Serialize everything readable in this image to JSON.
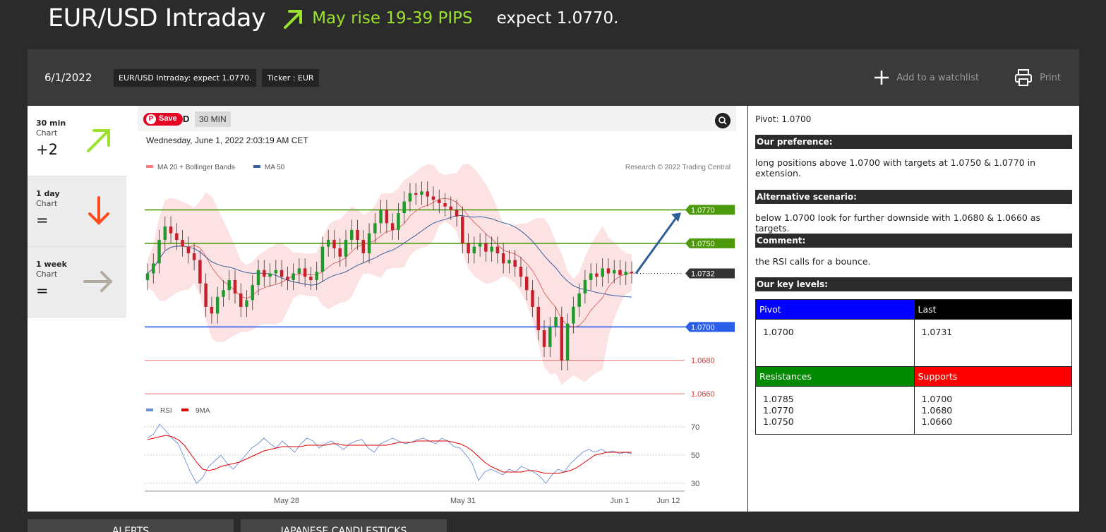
{
  "header": {
    "title": "EUR/USD Intraday",
    "arrow_icon": "arrow-up-right-icon",
    "rise_text": "May rise 19-39 PIPS",
    "expect_text": "expect 1.0770.",
    "accent_color": "#9be22d"
  },
  "infobar": {
    "date": "6/1/2022",
    "tags": [
      "EUR/USD Intraday: expect 1.0770.",
      "Ticker : EUR"
    ],
    "watchlist_label": "Add to a watchlist",
    "print_label": "Print"
  },
  "sidebar": {
    "items": [
      {
        "period": "30 min",
        "chart_label": "Chart",
        "score": "+2",
        "icon": "arrow-up-right-icon",
        "color": "#9be22d"
      },
      {
        "period": "1 day",
        "chart_label": "Chart",
        "score": "=",
        "icon": "arrow-down-icon",
        "color": "#ff4a1c"
      },
      {
        "period": "1 week",
        "chart_label": "Chart",
        "score": "=",
        "icon": "arrow-right-icon",
        "color": "#b3aaa0"
      }
    ]
  },
  "chart": {
    "save_label": "Save",
    "symbol_suffix": "D",
    "timeframe": "30 MIN",
    "timestamp": "Wednesday, June 1, 2022 2:03:19 AM CET",
    "legend": [
      {
        "name": "MA 20 + Bollinger Bands",
        "color": "#f08080"
      },
      {
        "name": "MA 50",
        "color": "#3a5f9e"
      }
    ],
    "credit": "Research © 2022 Trading Central",
    "rsi_legend": [
      {
        "name": "RSI",
        "color": "#6a8fd6"
      },
      {
        "name": "9MA",
        "color": "#e00000"
      }
    ]
  },
  "chart_data": {
    "type": "candlestick",
    "title": "",
    "x_ticks": [
      "May 28",
      "May 31",
      "Jun 1",
      "Jun 12"
    ],
    "y_range": [
      1.0655,
      1.079
    ],
    "levels": [
      {
        "label": "1.0770",
        "value": 1.077,
        "kind": "resistance",
        "color": "#4c9a0c"
      },
      {
        "label": "1.0750",
        "value": 1.075,
        "kind": "resistance",
        "color": "#4c9a0c"
      },
      {
        "label": "1.0732",
        "value": 1.0732,
        "kind": "last",
        "color": "#333333"
      },
      {
        "label": "1.0700",
        "value": 1.07,
        "kind": "pivot",
        "color": "#2a5ee8"
      },
      {
        "label": "1.0680",
        "value": 1.068,
        "kind": "support",
        "color": "#e03030"
      },
      {
        "label": "1.0660",
        "value": 1.066,
        "kind": "support",
        "color": "#e03030"
      }
    ],
    "target": {
      "from": 1.0732,
      "to": 1.077
    },
    "closes": [
      1.0732,
      1.0738,
      1.0752,
      1.076,
      1.0756,
      1.0752,
      1.0748,
      1.0744,
      1.074,
      1.0726,
      1.0712,
      1.0708,
      1.0718,
      1.0722,
      1.0728,
      1.072,
      1.0712,
      1.0716,
      1.0725,
      1.0734,
      1.073,
      1.0732,
      1.0734,
      1.073,
      1.0728,
      1.0732,
      1.0735,
      1.073,
      1.0728,
      1.0733,
      1.0748,
      1.0752,
      1.0747,
      1.0742,
      1.0752,
      1.0758,
      1.0752,
      1.0744,
      1.0756,
      1.0762,
      1.077,
      1.0762,
      1.0758,
      1.0768,
      1.0775,
      1.078,
      1.0779,
      1.0781,
      1.0778,
      1.0776,
      1.0774,
      1.0772,
      1.077,
      1.0766,
      1.075,
      1.0744,
      1.0748,
      1.075,
      1.0745,
      1.0748,
      1.0744,
      1.0738,
      1.074,
      1.0736,
      1.073,
      1.0722,
      1.0712,
      1.0698,
      1.0688,
      1.07,
      1.0706,
      1.068,
      1.0702,
      1.0712,
      1.072,
      1.0728,
      1.0732,
      1.073,
      1.0735,
      1.0732,
      1.0734,
      1.0731,
      1.0733,
      1.0732
    ],
    "rsi": {
      "y_ticks": [
        "70",
        "50",
        "30"
      ],
      "y_range": [
        25,
        75
      ],
      "rsi_values": [
        62,
        65,
        72,
        67,
        62,
        58,
        48,
        38,
        30,
        34,
        42,
        46,
        50,
        44,
        40,
        45,
        50,
        55,
        58,
        62,
        58,
        55,
        60,
        56,
        52,
        58,
        62,
        60,
        55,
        58,
        60,
        57,
        54,
        58,
        60,
        61,
        55,
        52,
        58,
        60,
        62,
        60,
        58,
        59,
        61,
        62,
        60,
        58,
        62,
        60,
        56,
        55,
        50,
        44,
        32,
        38,
        40,
        38,
        36,
        40,
        38,
        42,
        40,
        38,
        35,
        30,
        36,
        40,
        38,
        44,
        48,
        52,
        54,
        52,
        54,
        52,
        53,
        51,
        52,
        51
      ],
      "ma_values": [
        61,
        62,
        63,
        64,
        63,
        61,
        57,
        51,
        45,
        40,
        39,
        40,
        42,
        43,
        44,
        45,
        47,
        49,
        51,
        53,
        54,
        55,
        56,
        56,
        56,
        56,
        57,
        57,
        57,
        57,
        58,
        58,
        57,
        57,
        57,
        57,
        57,
        57,
        57,
        57,
        58,
        59,
        59,
        59,
        60,
        60,
        60,
        60,
        60,
        60,
        59,
        58,
        56,
        53,
        49,
        45,
        42,
        40,
        38,
        38,
        38,
        38,
        39,
        39,
        38,
        37,
        37,
        37,
        38,
        39,
        41,
        44,
        47,
        50,
        51,
        52,
        52,
        52,
        52,
        52
      ]
    }
  },
  "analysis": {
    "pivot_line": "Pivot: 1.0700",
    "preference_title": "Our preference:",
    "preference_text": "long positions above 1.0700 with targets at 1.0750 & 1.0770 in extension.",
    "alternative_title": "Alternative scenario:",
    "alternative_text": "below 1.0700 look for further downside with 1.0680 & 1.0660 as targets.",
    "comment_title": "Comment:",
    "comment_text": "the RSI calls for a bounce.",
    "key_levels_title": "Our key levels:",
    "key_levels": {
      "pivot_label": "Pivot",
      "pivot_color": "#0000ff",
      "last_label": "Last",
      "last_color": "#000000",
      "pivot_value": "1.0700",
      "last_value": "1.0731",
      "resistances_label": "Resistances",
      "resistances_color": "#008a00",
      "supports_label": "Supports",
      "supports_color": "#ff0000",
      "resistances": [
        "1.0785",
        "1.0770",
        "1.0750"
      ],
      "supports": [
        "1.0700",
        "1.0680",
        "1.0660"
      ]
    }
  },
  "bottom_tabs": [
    "ALERTS",
    "JAPANESE CANDLESTICKS"
  ]
}
